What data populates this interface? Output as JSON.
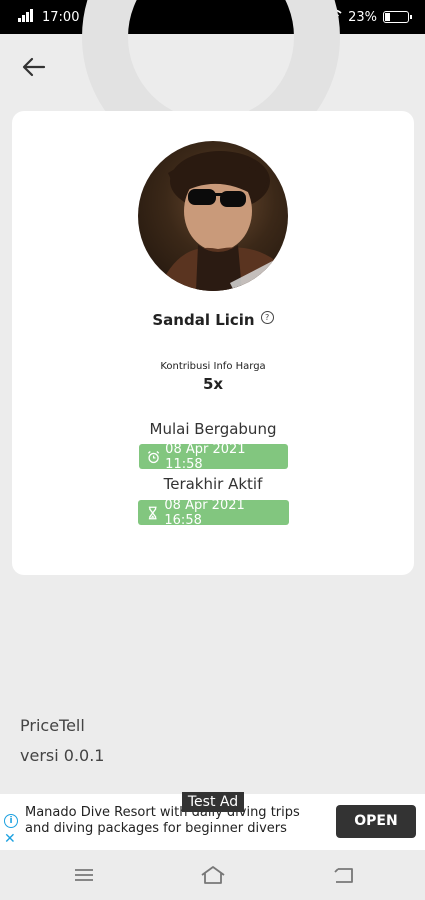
{
  "status_bar": {
    "time": "17:00",
    "battery_text": "23%",
    "battery_level": 0.23
  },
  "header": {
    "back_icon": "arrow-left-icon"
  },
  "profile": {
    "avatar_icon": "user-avatar",
    "username": "Sandal Licin",
    "help_icon": "question-circle-icon",
    "contribution_label": "Kontribusi Info Harga",
    "contribution_value": "5x",
    "join_label": "Mulai Bergabung",
    "join_icon": "alarm-clock-icon",
    "join_date": "08 Apr 2021 11:58",
    "active_label": "Terakhir Aktif",
    "active_icon": "hourglass-icon",
    "active_date": "08 Apr 2021 16:58",
    "badge_color": "#82c67f"
  },
  "app_info": {
    "name": "PriceTell",
    "version": "versi 0.0.1"
  },
  "ad": {
    "tag": "Test Ad",
    "text": "Manado Dive Resort with daily diving trips and diving packages for beginner divers",
    "button_label": "OPEN",
    "accent_color": "#1ca1e0"
  },
  "nav_bar": {
    "items": [
      "menu-icon",
      "home-icon",
      "back-icon"
    ]
  }
}
